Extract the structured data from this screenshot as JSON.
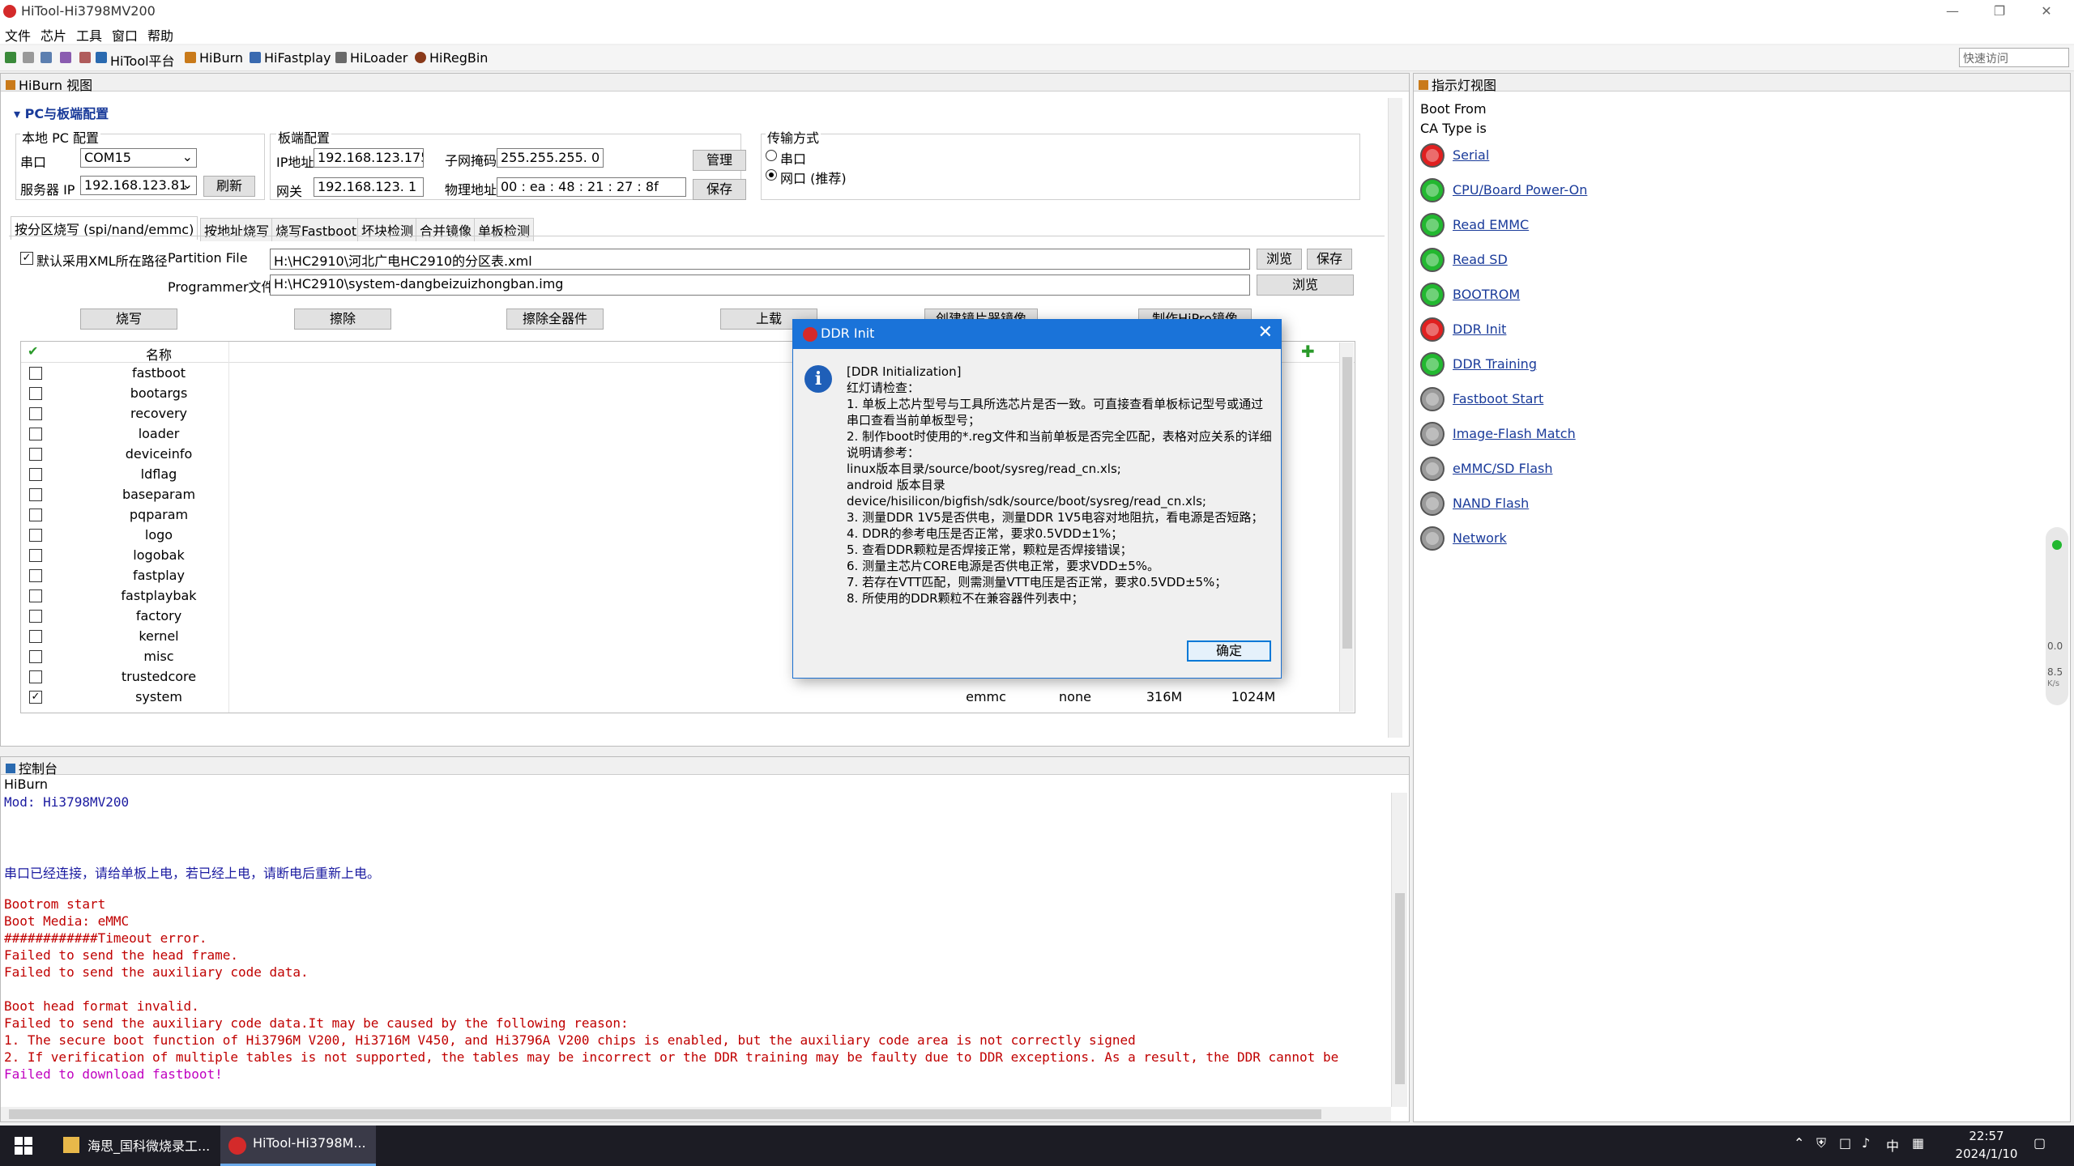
{
  "window": {
    "title": "HiTool-Hi3798MV200",
    "quick_access_placeholder": "快速访问"
  },
  "menu": [
    "文件",
    "芯片",
    "工具",
    "窗口",
    "帮助"
  ],
  "toolbar": {
    "items": [
      "HiTool平台",
      "HiBurn",
      "HiFastplay",
      "HiLoader",
      "HiRegBin"
    ]
  },
  "hiburn": {
    "view_title": "HiBurn 视图",
    "section_title": "PC与板端配置",
    "local_pc": {
      "group": "本地 PC 配置",
      "serial_label": "串口",
      "serial_value": "COM15",
      "server_ip_label": "服务器 IP",
      "server_ip_value": "192.168.123.81",
      "refresh": "刷新"
    },
    "board": {
      "group": "板端配置",
      "ip_label": "IP地址",
      "ip_value": "192.168.123.175",
      "mask_label": "子网掩码",
      "mask_value": "255.255.255. 0",
      "gateway_label": "网关",
      "gateway_value": "192.168.123. 1",
      "mac_label": "物理地址",
      "mac_value": "00 : ea : 48 : 21 : 27 : 8f",
      "manage": "管理",
      "save": "保存"
    },
    "transfer": {
      "group": "传输方式",
      "serial": "串口",
      "network": "网口 (推荐)",
      "selected": "网口 (推荐)"
    },
    "tabs": [
      "按分区烧写 (spi/nand/emmc)",
      "按地址烧写",
      "烧写Fastboot",
      "坏块检测",
      "合并镜像",
      "单板检测"
    ],
    "xml_checkbox": "默认采用XML所在路径",
    "partition_label": "Partition File",
    "partition_value": "H:\\HC2910\\河北广电HC2910的分区表.xml",
    "browse": "浏览",
    "save": "保存",
    "programmer_label": "Programmer文件",
    "programmer_value": "H:\\HC2910\\system-dangbeizuizhongban.img",
    "actions": [
      "烧写",
      "擦除",
      "擦除全器件",
      "上载",
      "创建镜片器镜像",
      "制作HiPro镜像"
    ],
    "table": {
      "header_name": "名称",
      "rows": [
        {
          "name": "fastboot",
          "checked": false
        },
        {
          "name": "bootargs",
          "checked": false
        },
        {
          "name": "recovery",
          "checked": false
        },
        {
          "name": "loader",
          "checked": false
        },
        {
          "name": "deviceinfo",
          "checked": false
        },
        {
          "name": "ldflag",
          "checked": false
        },
        {
          "name": "baseparam",
          "checked": false
        },
        {
          "name": "pqparam",
          "checked": false
        },
        {
          "name": "logo",
          "checked": false
        },
        {
          "name": "logobak",
          "checked": false
        },
        {
          "name": "fastplay",
          "checked": false
        },
        {
          "name": "fastplaybak",
          "checked": false
        },
        {
          "name": "factory",
          "checked": false
        },
        {
          "name": "kernel",
          "checked": false
        },
        {
          "name": "misc",
          "checked": false
        },
        {
          "name": "trustedcore",
          "checked": false
        },
        {
          "name": "system",
          "checked": true,
          "device": "emmc",
          "fs": "none",
          "start": "316M",
          "length": "1024M"
        }
      ]
    }
  },
  "console": {
    "title": "控制台",
    "sub": "HiBurn",
    "lines": [
      {
        "text": "Mod: Hi3798MV200",
        "color": "#1a1aa0"
      },
      {
        "text": "",
        "color": "#000"
      },
      {
        "text": "",
        "color": "#000"
      },
      {
        "text": "",
        "color": "#000"
      },
      {
        "text": "串口已经连接，请给单板上电，若已经上电，请断电后重新上电。",
        "color": "#1a1aa0"
      },
      {
        "text": "",
        "color": "#000"
      },
      {
        "text": "Bootrom start",
        "color": "#c00000"
      },
      {
        "text": "Boot Media: eMMC",
        "color": "#c00000"
      },
      {
        "text": "############Timeout error.",
        "color": "#c00000"
      },
      {
        "text": "Failed to send the head frame.",
        "color": "#c00000"
      },
      {
        "text": "Failed to send the auxiliary code data.",
        "color": "#c00000"
      },
      {
        "text": "",
        "color": "#000"
      },
      {
        "text": "Boot head format invalid.",
        "color": "#c00000"
      },
      {
        "text": "Failed to send the auxiliary code data.It may be caused by the following reason:",
        "color": "#c00000"
      },
      {
        "text": "1. The secure boot function of Hi3796M V200, Hi3716M V450, and Hi3796A V200 chips is enabled, but the auxiliary code area is not correctly signed",
        "color": "#c00000"
      },
      {
        "text": "2. If verification of multiple tables is not supported, the tables may be incorrect or the DDR training may be faulty due to DDR exceptions. As a result, the DDR cannot be",
        "color": "#c00000"
      },
      {
        "text": "Failed to download fastboot!",
        "color": "#c000c0"
      }
    ]
  },
  "indicator": {
    "title": "指示灯视图",
    "boot_from": "Boot From",
    "ca_type": "CA Type is",
    "lights": [
      {
        "label": "Serial",
        "state": "red"
      },
      {
        "label": "CPU/Board Power-On",
        "state": "green"
      },
      {
        "label": "Read EMMC",
        "state": "green"
      },
      {
        "label": "Read SD",
        "state": "green"
      },
      {
        "label": "BOOTROM",
        "state": "green"
      },
      {
        "label": "DDR Init",
        "state": "red"
      },
      {
        "label": "DDR Training",
        "state": "green"
      },
      {
        "label": "Fastboot Start",
        "state": "gray"
      },
      {
        "label": "Image-Flash Match",
        "state": "gray"
      },
      {
        "label": "eMMC/SD Flash",
        "state": "gray"
      },
      {
        "label": "NAND Flash",
        "state": "gray"
      },
      {
        "label": "Network",
        "state": "gray"
      }
    ],
    "colors": {
      "red": "#e02020",
      "green": "#22b830",
      "gray": "#9a9a9a"
    }
  },
  "dialog": {
    "title": "DDR Init",
    "lines": [
      "[DDR Initialization]",
      "红灯请检查：",
      "1. 单板上芯片型号与工具所选芯片是否一致。可直接查看单板标记型号或通过",
      "串口查看当前单板型号；",
      "2. 制作boot时使用的*.reg文件和当前单板是否完全匹配，表格对应关系的详细",
      "说明请参考：",
      "linux版本目录/source/boot/sysreg/read_cn.xls;",
      "android 版本目录",
      "device/hisilicon/bigfish/sdk/source/boot/sysreg/read_cn.xls;",
      "3. 测量DDR 1V5是否供电，测量DDR 1V5电容对地阻抗，看电源是否短路；",
      "4. DDR的参考电压是否正常，要求0.5VDD±1%；",
      "5. 查看DDR颗粒是否焊接正常，颗粒是否焊接错误；",
      "6. 测量主芯片CORE电源是否供电正常，要求VDD±5%。",
      "7. 若存在VTT匹配，则需测量VTT电压是否正常，要求0.5VDD±5%；",
      "8. 所使用的DDR颗粒不在兼容器件列表中；"
    ],
    "ok": "确定"
  },
  "taskbar": {
    "apps": [
      "海思_国科微烧录工...",
      "HiTool-Hi3798M..."
    ],
    "tray_lang": "中",
    "time": "22:57",
    "date": "2024/1/10"
  },
  "side_widget": {
    "up": "0.0",
    "down": "8.5",
    "unit": "K/s"
  }
}
